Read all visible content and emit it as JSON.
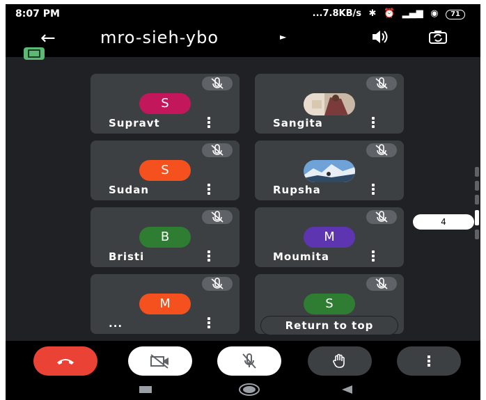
{
  "status_bar": {
    "time": "8:07 PM",
    "net_speed": "...7.8KB/s",
    "battery": "71"
  },
  "header": {
    "meeting_code": "mro-sieh-ybo"
  },
  "participants": [
    {
      "name": "Supravt",
      "initial": "S",
      "color": "#c2185b"
    },
    {
      "name": "Sangita",
      "initial": "",
      "color": "photo"
    },
    {
      "name": "Sudan",
      "initial": "S",
      "color": "#f4511e"
    },
    {
      "name": "Rupsha",
      "initial": "",
      "color": "photo"
    },
    {
      "name": "Bristi",
      "initial": "B",
      "color": "#2e7d32"
    },
    {
      "name": "Moumita",
      "initial": "M",
      "color": "#5e35b1"
    },
    {
      "name": "...",
      "initial": "M",
      "color": "#f4511e"
    },
    {
      "name": "",
      "initial": "S",
      "color": "#2e7d32"
    }
  ],
  "return_to_top": "Return to top",
  "page_indicator": "4",
  "colors": {
    "end_call": "#ea4335",
    "tile_bg": "#3c4043",
    "screen_bg": "#202124"
  }
}
